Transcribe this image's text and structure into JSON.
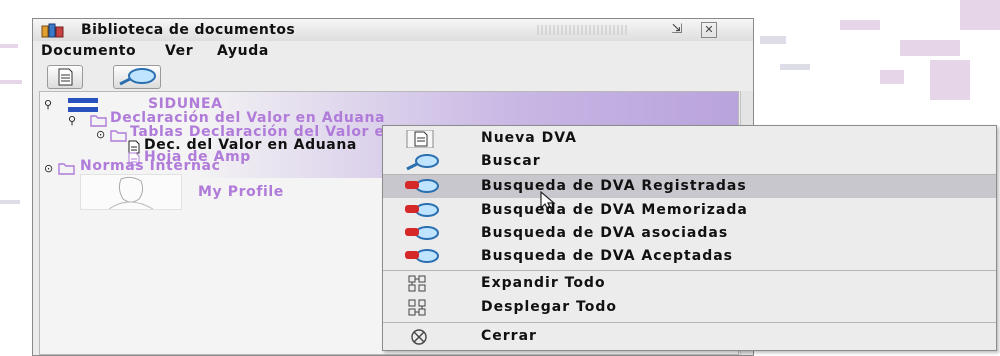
{
  "window": {
    "title": "Biblioteca de documentos"
  },
  "menubar": {
    "items": [
      "Documento",
      "Ver",
      "Ayuda"
    ]
  },
  "toolbar": {
    "buttons": [
      "document-icon",
      "search-icon"
    ]
  },
  "tree": {
    "root": "SIDUNEA",
    "declaracion": "Declaración del Valor en Aduana",
    "tablas": "Tablas Declaración del Valor en A",
    "dec": "Dec. del Valor en Aduana",
    "hoja": "Hoja de Amp",
    "normas": "Normas Internac",
    "profile": "My Profile"
  },
  "context_menu": {
    "items": [
      {
        "label": "Nueva DVA",
        "icon": "document-icon"
      },
      {
        "label": "Buscar",
        "icon": "search-icon"
      },
      {
        "label": "Busqueda de DVA Registradas",
        "icon": "search-red-icon",
        "highlighted": true
      },
      {
        "label": "Busqueda de DVA Memorizada",
        "icon": "search-red-icon"
      },
      {
        "label": "Busqueda de DVA asociadas",
        "icon": "search-red-icon"
      },
      {
        "label": "Busqueda de DVA Aceptadas",
        "icon": "search-red-icon"
      },
      {
        "label": "Expandir Todo",
        "icon": "expand-tree-icon"
      },
      {
        "label": "Desplegar Todo",
        "icon": "collapse-tree-icon"
      },
      {
        "label": "Cerrar",
        "icon": "close-circle-icon"
      }
    ]
  },
  "colors": {
    "accent_purple": "#b07bd9",
    "highlight": "#c7c7cd"
  }
}
